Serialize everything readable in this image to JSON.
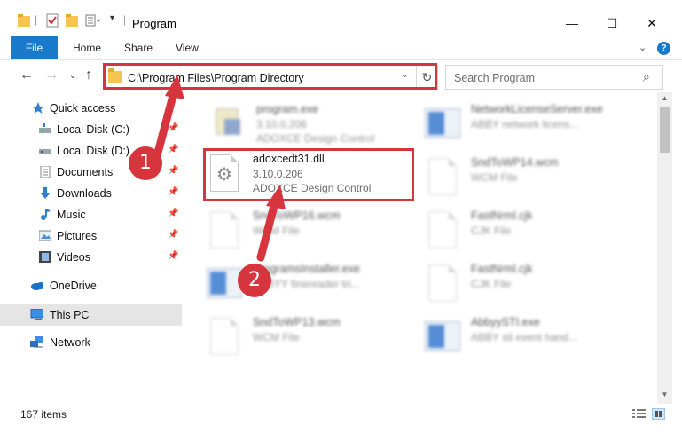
{
  "window": {
    "title": "Program",
    "minimize": "—",
    "maximize": "☐",
    "close": "✕"
  },
  "ribbon": {
    "tabs": [
      "File",
      "Home",
      "Share",
      "View"
    ],
    "expand": "⌄",
    "help": "?"
  },
  "nav": {
    "back": "←",
    "forward": "→",
    "recent": "⌄",
    "up": "↑",
    "address_path": "C:\\Program Files\\Program Directory",
    "address_dropdown": "⌄",
    "refresh": "↻",
    "search_placeholder": "Search Program",
    "search_icon": "⌕"
  },
  "sidebar": {
    "items": [
      {
        "label": "Quick access",
        "icon": "star-icon",
        "pinned": false
      },
      {
        "label": "Local Disk (C:)",
        "icon": "drive-icon",
        "pinned": true
      },
      {
        "label": "Local Disk (D:)",
        "icon": "drive-icon",
        "pinned": true
      },
      {
        "label": "Documents",
        "icon": "documents-icon",
        "pinned": true
      },
      {
        "label": "Downloads",
        "icon": "download-icon",
        "pinned": true
      },
      {
        "label": "Music",
        "icon": "music-icon",
        "pinned": true
      },
      {
        "label": "Pictures",
        "icon": "pictures-icon",
        "pinned": true
      },
      {
        "label": "Videos",
        "icon": "videos-icon",
        "pinned": true
      },
      {
        "label": "OneDrive",
        "icon": "onedrive-icon",
        "pinned": false
      },
      {
        "label": "This PC",
        "icon": "pc-icon",
        "pinned": false
      },
      {
        "label": "Network",
        "icon": "network-icon",
        "pinned": false
      }
    ],
    "pin_glyph": "📌"
  },
  "files": [
    {
      "name": "program.exe",
      "line1": "3.10.0.206",
      "line2": "ADOXCE Design Control",
      "kind": "exe"
    },
    {
      "name": "NetworkLicenseServer.exe",
      "line1": "ABBY network licens...",
      "line2": "",
      "kind": "app"
    },
    {
      "name": "adoxcedt31.dll",
      "line1": "3.10.0.206",
      "line2": "ADOXCE Design Control",
      "kind": "dll"
    },
    {
      "name": "SndToWP14.wcm",
      "line1": "WCM File",
      "line2": "",
      "kind": "doc"
    },
    {
      "name": "SndToWP16.wcm",
      "line1": "WCM File",
      "line2": "",
      "kind": "doc"
    },
    {
      "name": "FastNrml.cjk",
      "line1": "CJK File",
      "line2": "",
      "kind": "doc"
    },
    {
      "name": "ProgramsInstaller.exe",
      "line1": "ABBYY finereader tri...",
      "line2": "",
      "kind": "app"
    },
    {
      "name": "FastNrml.cjk",
      "line1": "CJK File",
      "line2": "",
      "kind": "doc"
    },
    {
      "name": "SndToWP13.wcm",
      "line1": "WCM File",
      "line2": "",
      "kind": "doc"
    },
    {
      "name": "AbbyySTI.exe",
      "line1": "ABBY sti event hand...",
      "line2": "",
      "kind": "app"
    }
  ],
  "status": {
    "item_count": "167 items"
  },
  "annotations": {
    "marker1": "1",
    "marker2": "2",
    "color": "#d6353e"
  },
  "colors": {
    "accent": "#1979ca",
    "selected_bg": "#cce8ff",
    "highlight": "#d6353e"
  }
}
